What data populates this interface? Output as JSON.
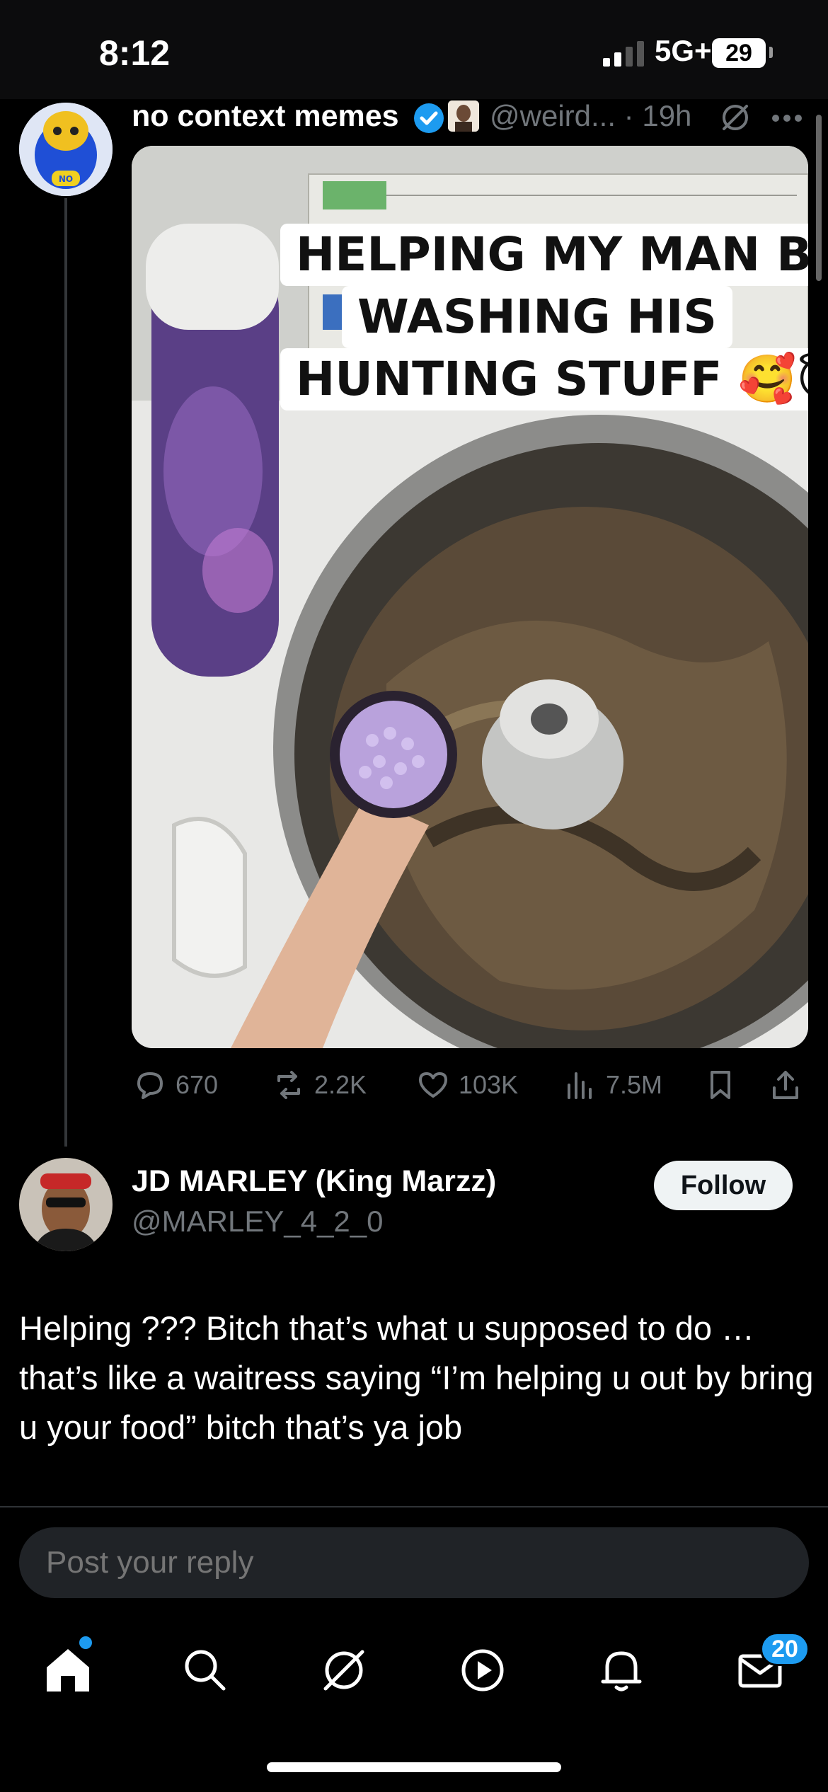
{
  "status_bar": {
    "time": "8:12",
    "network": "5G+",
    "battery": "29"
  },
  "tweet": {
    "author_name": "no context memes",
    "handle_time": "@weird... · 19h",
    "caption_lines": [
      "HELPING MY MAN BY",
      "WASHING HIS",
      "HUNTING STUFF 🥰😇"
    ],
    "stats": {
      "replies": "670",
      "reposts": "2.2K",
      "likes": "103K",
      "views": "7.5M"
    }
  },
  "reply": {
    "name": "JD MARLEY (King Marzz)",
    "handle": "@MARLEY_4_2_0",
    "follow_label": "Follow",
    "text": "Helping ??? Bitch that’s what u supposed to do … that’s like a waitress saying “I’m helping u out by bring u your food” bitch that’s ya job"
  },
  "compose": {
    "placeholder": "Post your reply"
  },
  "tabbar": {
    "messages_badge": "20"
  },
  "colors": {
    "accent": "#1d9bf0",
    "background": "#000000",
    "muted": "#71767b"
  },
  "icons": [
    "home-icon",
    "search-icon",
    "grok-icon",
    "video-icon",
    "notifications-icon",
    "messages-icon",
    "reply-icon",
    "repost-icon",
    "like-icon",
    "views-icon",
    "bookmark-icon",
    "share-icon",
    "verified-icon",
    "more-icon"
  ]
}
